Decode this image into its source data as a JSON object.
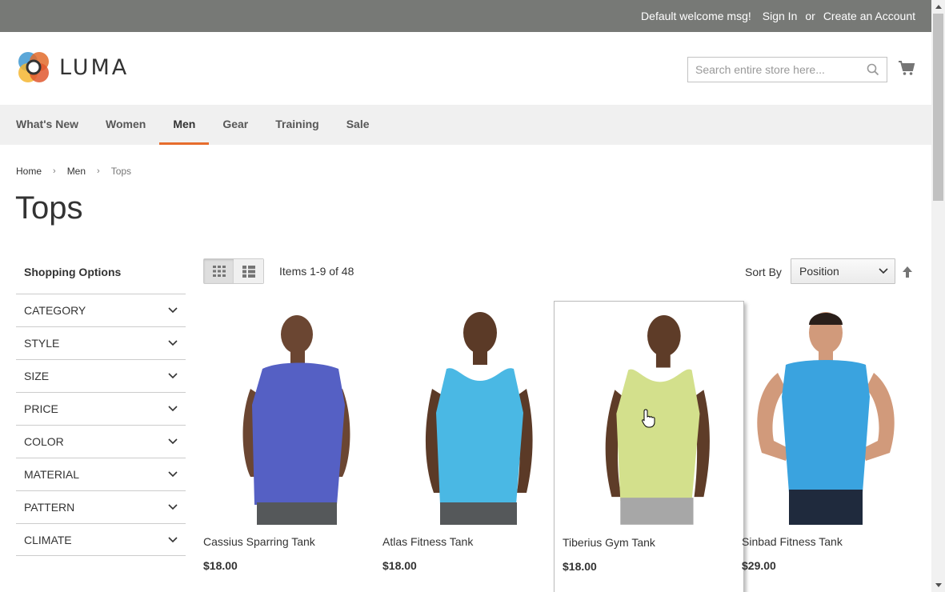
{
  "topbar": {
    "welcome": "Default welcome msg!",
    "sign_in": "Sign In",
    "or": "or",
    "create_account": "Create an Account"
  },
  "header": {
    "logo_text": "LUMA",
    "search_placeholder": "Search entire store here..."
  },
  "nav": {
    "items": [
      "What's New",
      "Women",
      "Men",
      "Gear",
      "Training",
      "Sale"
    ],
    "active": "Men"
  },
  "breadcrumb": [
    "Home",
    "Men",
    "Tops"
  ],
  "page_title": "Tops",
  "sidebar": {
    "title": "Shopping Options",
    "filters": [
      "CATEGORY",
      "STYLE",
      "SIZE",
      "PRICE",
      "COLOR",
      "MATERIAL",
      "PATTERN",
      "CLIMATE"
    ]
  },
  "toolbar": {
    "amount": "Items 1-9 of 48",
    "sort_label": "Sort By",
    "sort_value": "Position",
    "view_mode": "grid"
  },
  "products": [
    {
      "name": "Cassius Sparring Tank",
      "price": "$18.00",
      "color": "#5560c4"
    },
    {
      "name": "Atlas Fitness Tank",
      "price": "$18.00",
      "color": "#4ab8e4"
    },
    {
      "name": "Tiberius Gym Tank",
      "price": "$18.00",
      "color": "#d3e08c"
    },
    {
      "name": "Sinbad Fitness Tank",
      "price": "$29.00",
      "color": "#3aa3df"
    }
  ],
  "colors": {
    "topbar_bg": "#777976",
    "nav_bg": "#f0f0f0",
    "accent": "#e66c2c"
  }
}
